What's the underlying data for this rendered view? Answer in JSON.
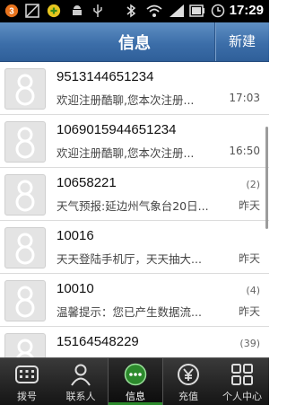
{
  "status_bar": {
    "time": "17:29",
    "notification_count": "3",
    "icons": [
      "notification-badge-icon",
      "image-icon",
      "app-icon",
      "android-icon",
      "usb-icon",
      "bluetooth-icon",
      "wifi-icon",
      "signal-icon",
      "battery-icon",
      "alarm-icon"
    ]
  },
  "header": {
    "title": "信息",
    "new_button": "新建"
  },
  "messages": [
    {
      "sender": "9513144651234",
      "snippet": "欢迎注册酷聊,您本次注册...",
      "count": "",
      "time": "17:03"
    },
    {
      "sender": "1069015944651234",
      "snippet": "欢迎注册酷聊,您本次注册...",
      "count": "",
      "time": "16:50"
    },
    {
      "sender": "10658221",
      "snippet": "天气预报:延边州气象台20日...",
      "count": "(2)",
      "time": "昨天"
    },
    {
      "sender": "10016",
      "snippet": "天天登陆手机厅，天天抽大...",
      "count": "",
      "time": "昨天"
    },
    {
      "sender": "10010",
      "snippet": "温馨提示：您已产生数据流...",
      "count": "(4)",
      "time": "昨天"
    },
    {
      "sender": "15164548229",
      "snippet": "",
      "count": "(39)",
      "time": ""
    }
  ],
  "tabs": [
    {
      "label": "拨号",
      "icon": "dialpad-icon"
    },
    {
      "label": "联系人",
      "icon": "contact-icon"
    },
    {
      "label": "信息",
      "icon": "message-icon"
    },
    {
      "label": "充值",
      "icon": "recharge-icon"
    },
    {
      "label": "个人中心",
      "icon": "personal-center-icon"
    }
  ],
  "colors": {
    "header": "#3c6ea9",
    "active_tab_indicator": "#2c8a2c",
    "tabbar": "#151515"
  }
}
